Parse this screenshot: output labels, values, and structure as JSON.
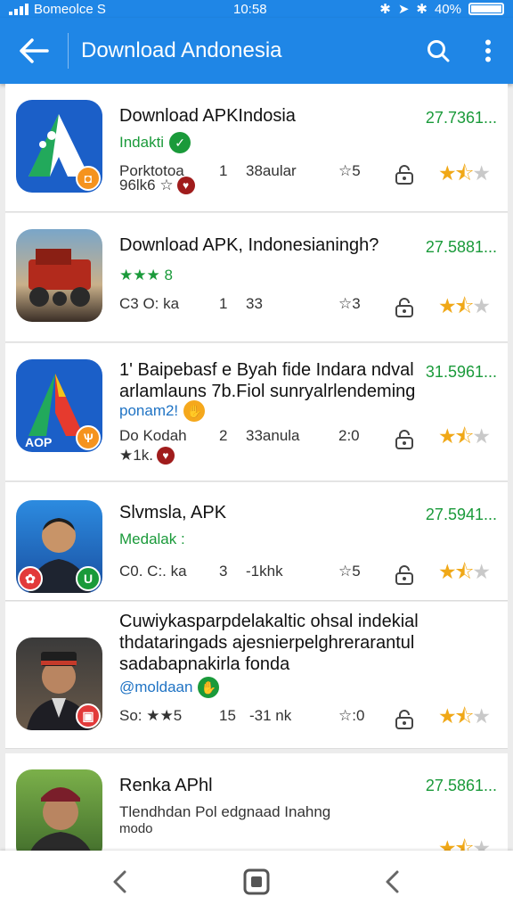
{
  "status": {
    "carrier": "Bomeolce S",
    "time": "10:58",
    "battery": "40%"
  },
  "appbar": {
    "title": "Download Andonesia"
  },
  "items": [
    {
      "title_lines": [
        "Download APKIndosia"
      ],
      "subtitle": "Indakti",
      "subtitle_color": "#1a9a3a",
      "price": "27.7361...",
      "meta_a": "Porktotoa",
      "meta_b": "1",
      "meta_c": "38aular",
      "rating_label": "☆5",
      "meta2": "96lk6 ☆",
      "stars": 1.5
    },
    {
      "title_lines": [
        "Download APK, Indonesianingh?"
      ],
      "subtitle": "★★★ 8",
      "subtitle_color": "#1a9a3a",
      "price": "27.5881...",
      "meta_a": "C3 O: ka",
      "meta_b": "1",
      "meta_c": "33",
      "rating_label": "☆3",
      "meta2": "",
      "stars": 1.5
    },
    {
      "title_lines": [
        "1' Baipebasf e Byah fide Indara ndval",
        "arlamlauns 7b.Fiol sunryalrlendeming"
      ],
      "subtitle": "ponam2!",
      "subtitle_color": "#1f73c4",
      "price": "31.5961...",
      "meta_a": "Do Kodah",
      "meta_b": "2",
      "meta_c": "33anula",
      "rating_label": "2:0",
      "meta2": "★1k.",
      "stars": 1.5
    },
    {
      "title_lines": [
        "Slvmsla, APK"
      ],
      "subtitle": "Medalak :",
      "subtitle_color": "#1a9a3a",
      "price": "27.5941...",
      "meta_a": "C0. C:. ka",
      "meta_b": "3",
      "meta_c": "-1khk",
      "rating_label": "☆5",
      "meta2": "",
      "stars": 1.5
    },
    {
      "title_lines": [
        "Cuwiykasparpdelakaltic ohsal indekial",
        "thdataringads ajesnierpelghrerarantul",
        "sadabapnakirla fonda"
      ],
      "subtitle": "@moldaan",
      "subtitle_color": "#1f73c4",
      "price": "",
      "meta_a": "So: ★★5",
      "meta_b": "15",
      "meta_c": "-31 nk",
      "rating_label": "☆:0",
      "meta2": "",
      "stars": 1.5
    },
    {
      "title_lines": [
        "Renka APhl"
      ],
      "subtitle": "Tlendhdan Pol edgnaad Inahng",
      "subtitle_color": "#333333",
      "price": "27.5861...",
      "meta_a": "modo",
      "meta_b": "",
      "meta_c": "",
      "rating_label": "",
      "meta2": "",
      "stars": 1.5
    }
  ]
}
